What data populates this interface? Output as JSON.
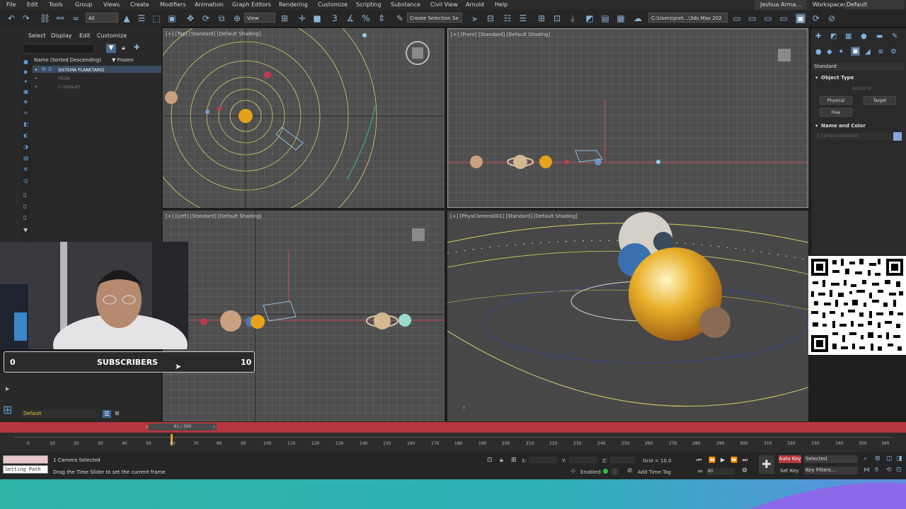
{
  "menubar": {
    "items": [
      "File",
      "Edit",
      "Tools",
      "Group",
      "Views",
      "Create",
      "Modifiers",
      "Animation",
      "Graph Editors",
      "Rendering",
      "Customize",
      "Scripting",
      "Substance",
      "Civil View",
      "Arnold",
      "Help"
    ],
    "user": "Jeshua Arma...",
    "workspaces_label": "Workspaces:",
    "workspace_value": "Default"
  },
  "toolbar": {
    "filter_select": "All",
    "view_select": "View",
    "selection_set": "Create Selection Se",
    "path_field": "C:\\Users\\jesh...\\3ds Max 202"
  },
  "scene_explorer": {
    "tabs": [
      "Select",
      "Display",
      "Edit",
      "Customize"
    ],
    "col_name": "Name (Sorted Descending)",
    "col_frozen": "▼ Frozen",
    "items": [
      "SISTEMA PLANETARIO",
      "PEON",
      "0 (default)"
    ],
    "layer_default": "Default"
  },
  "viewports": {
    "top": "[+] [Top] [Standard] [Default Shading]",
    "front": "[+] [Front] [Standard] [Default Shading]",
    "left": "[+] [Left] [Standard] [Default Shading]",
    "camera": "[+] [PhysCamera001] [Standard] [Default Shading]"
  },
  "command_panel": {
    "dropdown": "Standard",
    "object_type": "Object Type",
    "autogrid": "AutoGrid",
    "buttons": [
      "Physical",
      "Target",
      "Free"
    ],
    "name_color": "Name and Color",
    "name_field": "1 Camera Selected"
  },
  "overlay": {
    "subs_left": "0",
    "subs_label": "SUBSCRIBERS",
    "subs_right": "10"
  },
  "timeline": {
    "slider": "61 / 360",
    "ticks": [
      "0",
      "10",
      "20",
      "30",
      "40",
      "50",
      "60",
      "70",
      "80",
      "90",
      "100",
      "110",
      "120",
      "130",
      "140",
      "150",
      "160",
      "170",
      "180",
      "190",
      "200",
      "210",
      "220",
      "230",
      "240",
      "250",
      "260",
      "270",
      "280",
      "290",
      "300",
      "310",
      "320",
      "330",
      "340",
      "350",
      "360"
    ]
  },
  "status": {
    "setting_path": "Setting Path",
    "selection": "1 Camera Selected",
    "prompt": "Drag the Time Slider to set the current frame",
    "x": "X:",
    "y": "Y:",
    "z": "Z:",
    "grid": "Grid = 10.0",
    "enabled": "Enabled:",
    "add_time_tag": "Add Time Tag",
    "auto_key": "Auto Key",
    "selected": "Selected",
    "set_key": "Set Key",
    "key_filters": "Key Filters...",
    "frame": "60"
  },
  "colors": {
    "accent_red": "#b4373f",
    "teal": "#2eb3a7",
    "sun": "#e6a21b"
  }
}
